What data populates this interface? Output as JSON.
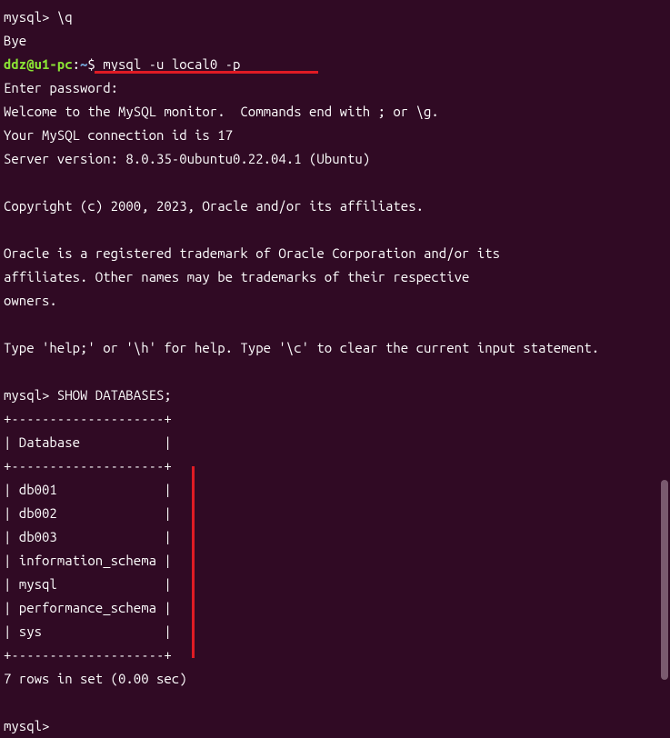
{
  "lines": {
    "l0": "mysql> \\q",
    "l1": "Bye",
    "prompt_user": "ddz@u1-pc",
    "prompt_colon": ":",
    "prompt_tilde": "~",
    "prompt_dollar": "$ ",
    "cmd": "mysql -u local0 -p",
    "l3": "Enter password:",
    "l4": "Welcome to the MySQL monitor.  Commands end with ; or \\g.",
    "l5": "Your MySQL connection id is 17",
    "l6": "Server version: 8.0.35-0ubuntu0.22.04.1 (Ubuntu)",
    "l7": "",
    "l8": "Copyright (c) 2000, 2023, Oracle and/or its affiliates.",
    "l9": "",
    "l10": "Oracle is a registered trademark of Oracle Corporation and/or its",
    "l11": "affiliates. Other names may be trademarks of their respective",
    "l12": "owners.",
    "l13": "",
    "l14": "Type 'help;' or '\\h' for help. Type '\\c' to clear the current input statement.",
    "l15": "",
    "l16": "mysql> SHOW DATABASES;",
    "l17": "+--------------------+",
    "l18": "| Database           |",
    "l19": "+--------------------+",
    "l20": "| db001              |",
    "l21": "| db002              |",
    "l22": "| db003              |",
    "l23": "| information_schema |",
    "l24": "| mysql              |",
    "l25": "| performance_schema |",
    "l26": "| sys                |",
    "l27": "+--------------------+",
    "l28": "7 rows in set (0.00 sec)",
    "l29": "",
    "l30": "mysql> "
  },
  "chart_data": {
    "type": "table",
    "title": "SHOW DATABASES",
    "columns": [
      "Database"
    ],
    "rows": [
      [
        "db001"
      ],
      [
        "db002"
      ],
      [
        "db003"
      ],
      [
        "information_schema"
      ],
      [
        "mysql"
      ],
      [
        "performance_schema"
      ],
      [
        "sys"
      ]
    ],
    "row_count": 7,
    "elapsed_sec": 0.0
  }
}
